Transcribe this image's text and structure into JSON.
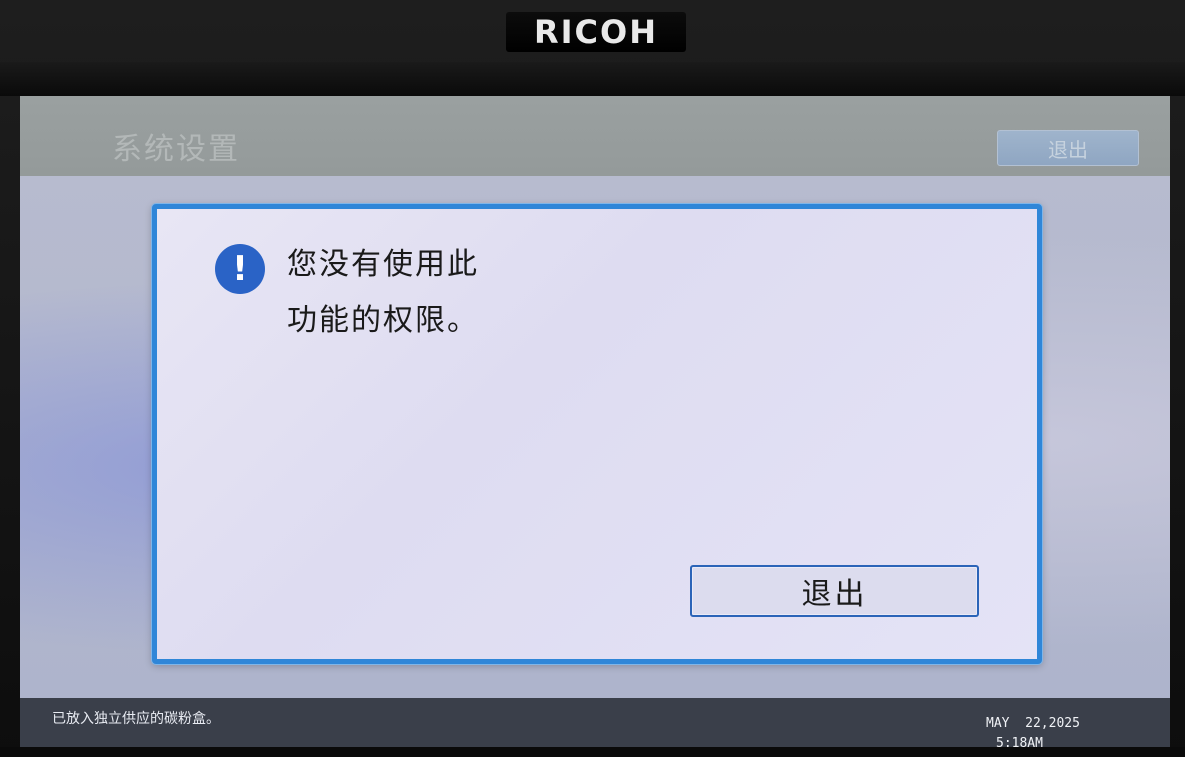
{
  "device": {
    "brand": "RICOH"
  },
  "header": {
    "title": "系统设置",
    "exit_label": "退出"
  },
  "dialog": {
    "icon": "exclamation-icon",
    "message_line1": "您没有使用此",
    "message_line2": "功能的权限。",
    "exit_label": "退出"
  },
  "status_bar": {
    "message": "已放入独立供应的碳粉盒。",
    "date": "MAY  22,2025",
    "time": "5:18AM"
  },
  "colors": {
    "dialog_border": "#2f86d8",
    "icon_bg": "#2a63c6",
    "button_border": "#2b64b8"
  }
}
